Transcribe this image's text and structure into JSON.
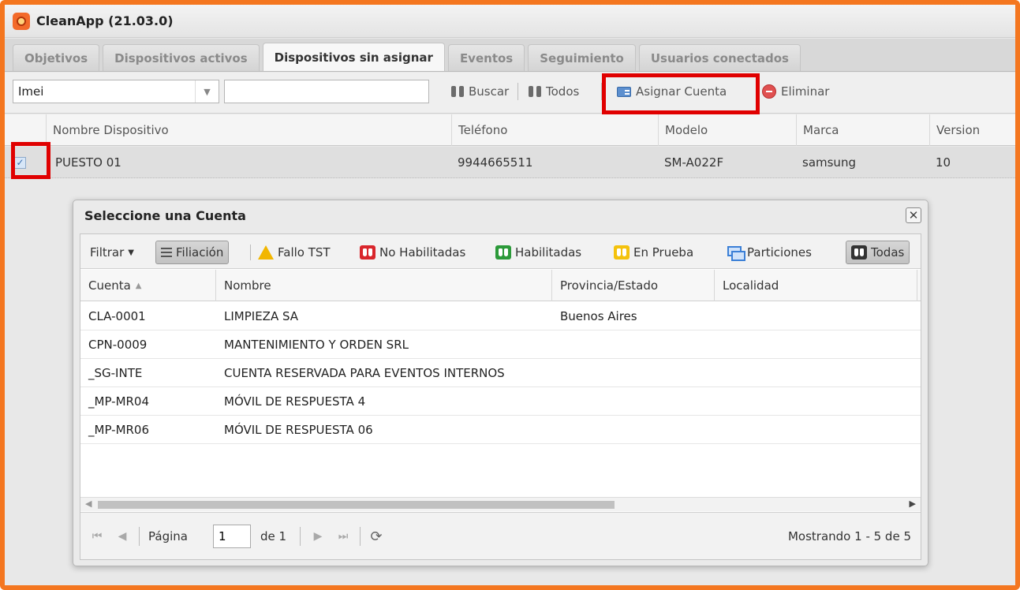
{
  "app": {
    "title": "CleanApp (21.03.0)"
  },
  "tabs": [
    {
      "label": "Objetivos",
      "active": false
    },
    {
      "label": "Dispositivos activos",
      "active": false
    },
    {
      "label": "Dispositivos sin asignar",
      "active": true
    },
    {
      "label": "Eventos",
      "active": false
    },
    {
      "label": "Seguimiento",
      "active": false
    },
    {
      "label": "Usuarios conectados",
      "active": false
    }
  ],
  "toolbar": {
    "field_select": "Imei",
    "search_value": "",
    "buscar": "Buscar",
    "todos": "Todos",
    "asignar": "Asignar Cuenta",
    "eliminar": "Eliminar"
  },
  "grid": {
    "columns": [
      "Nombre Dispositivo",
      "Teléfono",
      "Modelo",
      "Marca",
      "Version"
    ],
    "rows": [
      {
        "checked": true,
        "nombre": "PUESTO 01",
        "telefono": "9944665511",
        "modelo": "SM-A022F",
        "marca": "samsung",
        "version": "10"
      }
    ]
  },
  "dialog": {
    "title": "Seleccione una Cuenta",
    "filters": {
      "filtrar": "Filtrar",
      "filiacion": "Filiación",
      "fallo_tst": "Fallo TST",
      "no_habilitadas": "No Habilitadas",
      "habilitadas": "Habilitadas",
      "en_prueba": "En Prueba",
      "particiones": "Particiones",
      "todas": "Todas"
    },
    "columns": [
      "Cuenta",
      "Nombre",
      "Provincia/Estado",
      "Localidad"
    ],
    "rows": [
      {
        "cuenta": "CLA-0001",
        "nombre": "LIMPIEZA SA",
        "provincia": "Buenos Aires",
        "localidad": ""
      },
      {
        "cuenta": "CPN-0009",
        "nombre": "MANTENIMIENTO Y ORDEN SRL",
        "provincia": "",
        "localidad": ""
      },
      {
        "cuenta": "_SG-INTE",
        "nombre": "CUENTA RESERVADA PARA EVENTOS INTERNOS",
        "provincia": "",
        "localidad": ""
      },
      {
        "cuenta": "_MP-MR04",
        "nombre": "MÓVIL DE RESPUESTA 4",
        "provincia": "",
        "localidad": ""
      },
      {
        "cuenta": "_MP-MR06",
        "nombre": "MÓVIL DE RESPUESTA 06",
        "provincia": "",
        "localidad": ""
      }
    ],
    "pager": {
      "page_label": "Página",
      "page_value": "1",
      "of_label": "de 1",
      "summary": "Mostrando 1 - 5 de 5"
    }
  },
  "colors": {
    "frame": "#f4761f",
    "highlight": "#e00000"
  }
}
